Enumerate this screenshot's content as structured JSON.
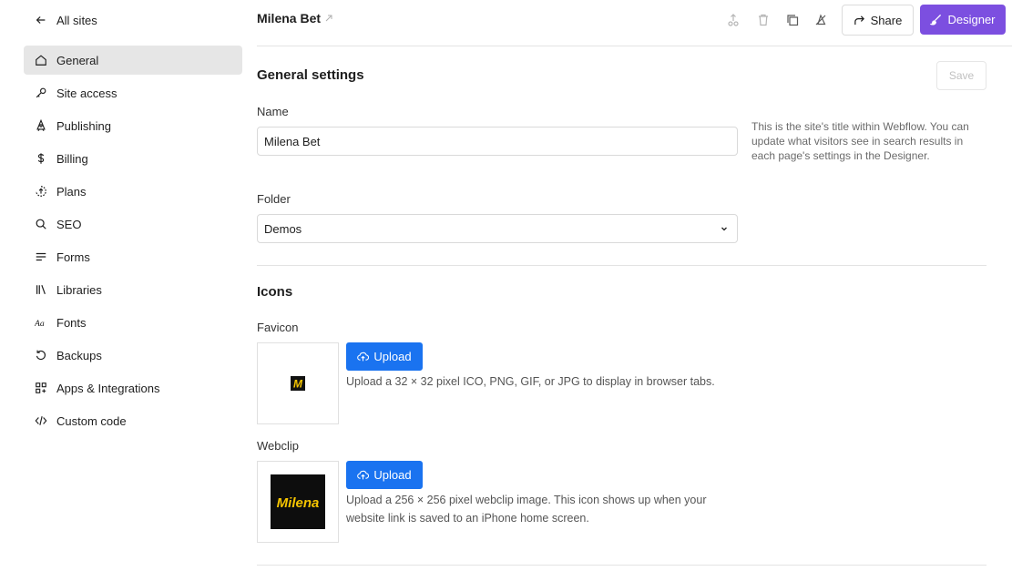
{
  "nav": {
    "back_label": "All sites",
    "items": [
      {
        "label": "General",
        "icon": "home-icon"
      },
      {
        "label": "Site access",
        "icon": "key-icon"
      },
      {
        "label": "Publishing",
        "icon": "rocket-icon"
      },
      {
        "label": "Billing",
        "icon": "dollar-icon"
      },
      {
        "label": "Plans",
        "icon": "plans-icon"
      },
      {
        "label": "SEO",
        "icon": "search-icon"
      },
      {
        "label": "Forms",
        "icon": "forms-icon"
      },
      {
        "label": "Libraries",
        "icon": "libraries-icon"
      },
      {
        "label": "Fonts",
        "icon": "fonts-icon"
      },
      {
        "label": "Backups",
        "icon": "backup-icon"
      },
      {
        "label": "Apps & Integrations",
        "icon": "apps-icon"
      },
      {
        "label": "Custom code",
        "icon": "code-icon"
      }
    ]
  },
  "header": {
    "site_name": "Milena Bet",
    "share_label": "Share",
    "designer_label": "Designer"
  },
  "general": {
    "title": "General settings",
    "save_label": "Save",
    "name_label": "Name",
    "name_value": "Milena Bet",
    "name_help": "This is the site's title within Webflow. You can update what visitors see in search results in each page's settings in the Designer.",
    "folder_label": "Folder",
    "folder_value": "Demos"
  },
  "icons": {
    "title": "Icons",
    "favicon_label": "Favicon",
    "favicon_upload": "Upload",
    "favicon_desc": "Upload a 32 × 32 pixel ICO, PNG, GIF, or JPG to display in browser tabs.",
    "webclip_label": "Webclip",
    "webclip_upload": "Upload",
    "webclip_desc": "Upload a 256 × 256 pixel webclip image. This icon shows up when your website link is saved to an iPhone home screen.",
    "favicon_logo_text": "M",
    "webclip_logo_text": "Milena"
  },
  "colors": {
    "accent": "#7c4fe0",
    "upload": "#1a73f0",
    "logo_yellow": "#f5c400"
  }
}
